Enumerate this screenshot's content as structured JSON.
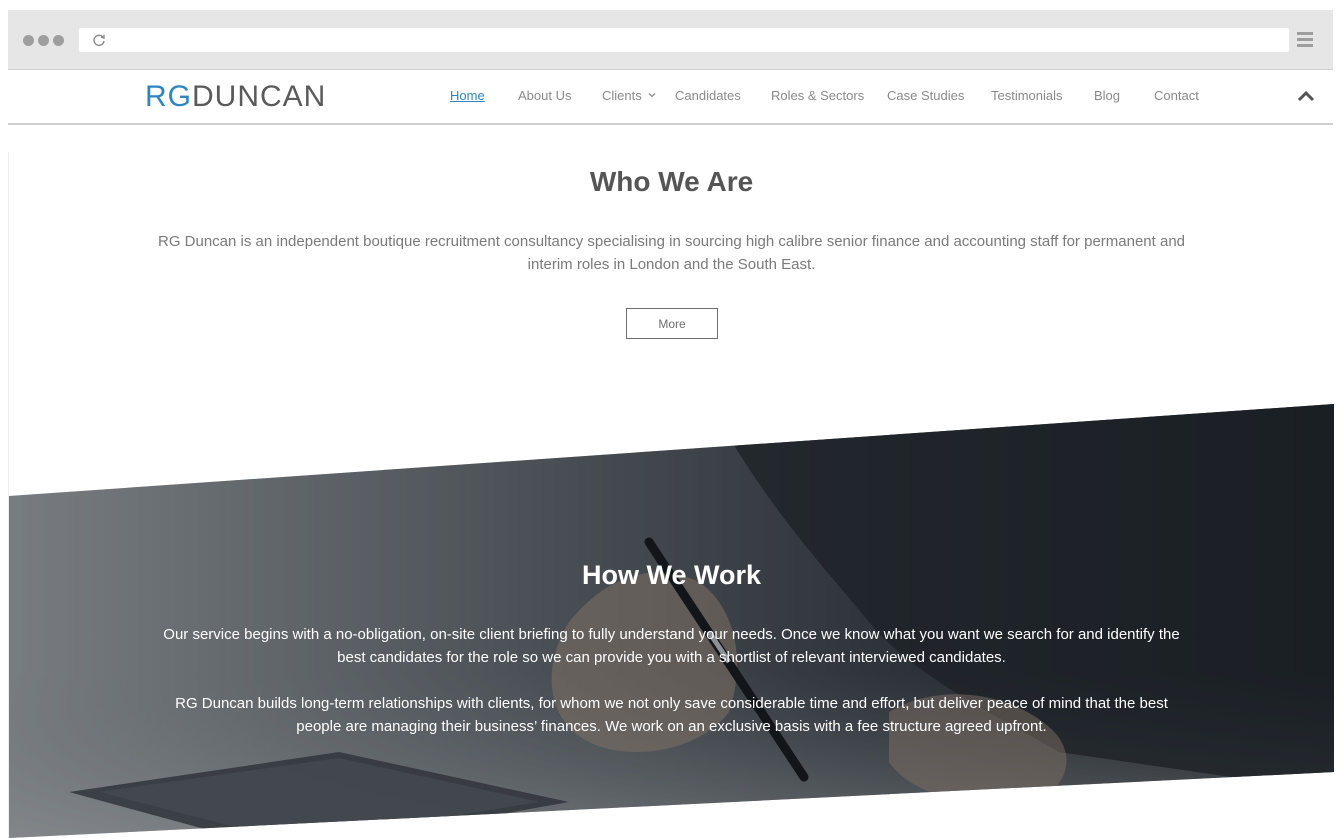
{
  "header": {
    "logo_rg": "RG",
    "logo_duncan": "DUNCAN",
    "nav": [
      "Home",
      "About Us",
      "Clients",
      "Candidates",
      "Roles & Sectors",
      "Case Studies",
      "Testimonials",
      "Blog",
      "Contact"
    ],
    "active_nav": "Home"
  },
  "who": {
    "title": "Who We Are",
    "text": "RG Duncan is an independent boutique recruitment consultancy specialising in sourcing high calibre senior finance and accounting staff for permanent and interim roles in London and the South East.",
    "button": "More"
  },
  "how": {
    "title": "How We Work",
    "p1": "Our service begins with a no-obligation, on-site client briefing to fully understand your needs. Once we know what you want we search for and identify the best candidates for the role so we can provide you with a shortlist of relevant interviewed candidates.",
    "p2": "RG Duncan builds long-term relationships with clients, for whom we not only save considerable time and effort, but deliver peace of mind that the best people are managing their business’ finances. We work on an exclusive basis with a fee structure agreed upfront."
  },
  "icons": [
    "window-dots-icon",
    "reload-icon",
    "hamburger-menu-icon",
    "chevron-down-icon",
    "scroll-top-icon"
  ],
  "colors": {
    "accent": "#2e86c1",
    "text": "#7a7a7a",
    "band": "#2f3338"
  }
}
